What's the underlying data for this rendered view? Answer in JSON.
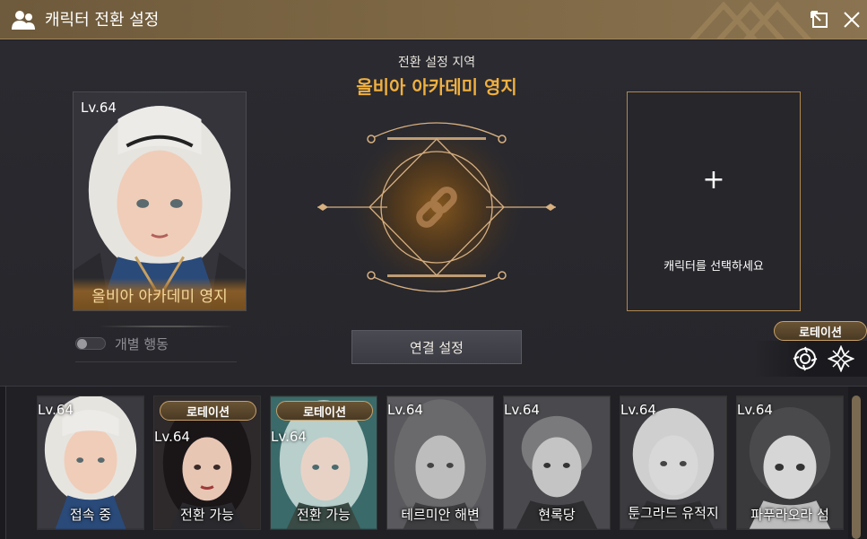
{
  "window": {
    "title": "캐릭터 전환 설정",
    "icons": {
      "title": "users-icon",
      "popout": "popout-icon",
      "close": "close-icon"
    }
  },
  "current_character": {
    "level": "Lv.64",
    "region": "올비아 아카데미 영지"
  },
  "individual_action": {
    "label": "개별 행동",
    "enabled": false
  },
  "center": {
    "subtitle": "전환 설정 지역",
    "region": "올비아 아카데미 영지",
    "emblem_icon": "link-icon",
    "connect_button": "연결 설정"
  },
  "target_slot": {
    "plus": "+",
    "message": "캐릭터를 선택하세요"
  },
  "rotation": {
    "label": "로테이션",
    "icons": [
      "flower-emblem-icon",
      "cross-emblem-icon"
    ]
  },
  "characters": [
    {
      "level": "Lv.64",
      "label": "접속 중",
      "badge": "",
      "tone": "color-blonde"
    },
    {
      "level": "Lv.64",
      "label": "전환 가능",
      "badge": "로테이션",
      "tone": "color-dark"
    },
    {
      "level": "Lv.64",
      "label": "전환 가능",
      "badge": "로테이션",
      "tone": "color-teal"
    },
    {
      "level": "Lv.64",
      "label": "테르미안 해변",
      "badge": "",
      "tone": "gray"
    },
    {
      "level": "Lv.64",
      "label": "현록당",
      "badge": "",
      "tone": "gray"
    },
    {
      "level": "Lv.64",
      "label": "툰그라드 유적지",
      "badge": "",
      "tone": "gray"
    },
    {
      "level": "Lv.64",
      "label": "파푸라오라 섬",
      "badge": "",
      "tone": "gray"
    }
  ],
  "colors": {
    "accent_gold": "#f0b040",
    "frame_gold": "#b08850",
    "titlebar": "#7d6744"
  }
}
